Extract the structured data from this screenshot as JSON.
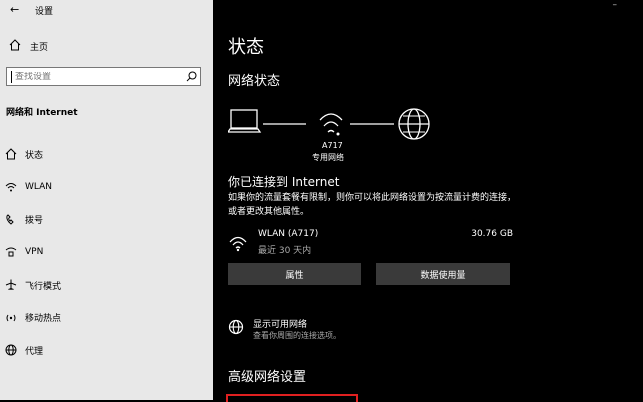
{
  "window": {
    "title": "设置",
    "back_icon": "back-arrow-icon"
  },
  "sidebar": {
    "home_label": "主页",
    "search_placeholder": "查找设置",
    "section_title": "网络和 Internet",
    "items": [
      {
        "label": "状态",
        "icon": "home-icon"
      },
      {
        "label": "WLAN",
        "icon": "wifi-icon"
      },
      {
        "label": "拨号",
        "icon": "dialup-icon"
      },
      {
        "label": "VPN",
        "icon": "vpn-icon"
      },
      {
        "label": "飞行模式",
        "icon": "airplane-icon"
      },
      {
        "label": "移动热点",
        "icon": "hotspot-icon"
      },
      {
        "label": "代理",
        "icon": "globe-icon"
      }
    ]
  },
  "main": {
    "title": "状态",
    "network_status_title": "网络状态",
    "network_name": "A717",
    "network_type": "专用网络",
    "connected_title": "你已连接到 Internet",
    "connected_desc": "如果你的流量套餐有限制，则你可以将此网络设置为按流量计费的连接，或者更改其他属性。",
    "wlan_name": "WLAN (A717)",
    "wlan_time": "最近 30 天内",
    "wlan_size": "30.76 GB",
    "properties_button": "属性",
    "data_usage_button": "数据使用量",
    "show_available_title": "显示可用网络",
    "show_available_desc": "查看你周围的连接选项。",
    "advanced_title": "高级网络设置"
  },
  "colors": {
    "sidebar_bg": "#e8e8e8",
    "main_bg": "#000000",
    "button_bg": "#3a3a3a",
    "highlight": "#e02020"
  }
}
